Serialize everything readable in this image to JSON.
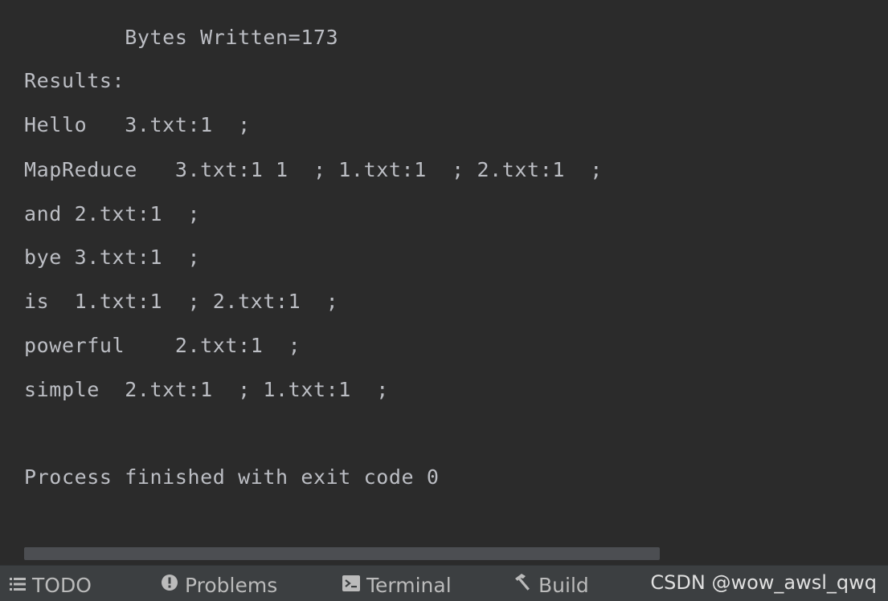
{
  "console": {
    "lines": [
      "        Bytes Written=173",
      "Results:",
      "Hello   3.txt:1  ;",
      "MapReduce   3.txt:1 1  ; 1.txt:1  ; 2.txt:1  ;",
      "and 2.txt:1  ;",
      "bye 3.txt:1  ;",
      "is  1.txt:1  ; 2.txt:1  ;",
      "powerful    2.txt:1  ;",
      "simple  2.txt:1  ; 1.txt:1  ;",
      "Process finished with exit code 0"
    ]
  },
  "toolbar": {
    "todo_label": "TODO",
    "problems_label": "Problems",
    "terminal_label": "Terminal",
    "build_label": "Build"
  },
  "icons": {
    "todo": "list-icon",
    "problems": "alert-circle-icon",
    "terminal": "terminal-icon",
    "build": "hammer-icon"
  },
  "watermark": "CSDN @wow_awsl_qwq",
  "colors": {
    "console_bg": "#2b2b2b",
    "console_text": "#bcbec4",
    "toolbar_bg": "#3c3f41",
    "toolbar_text": "#bbbbbb"
  }
}
